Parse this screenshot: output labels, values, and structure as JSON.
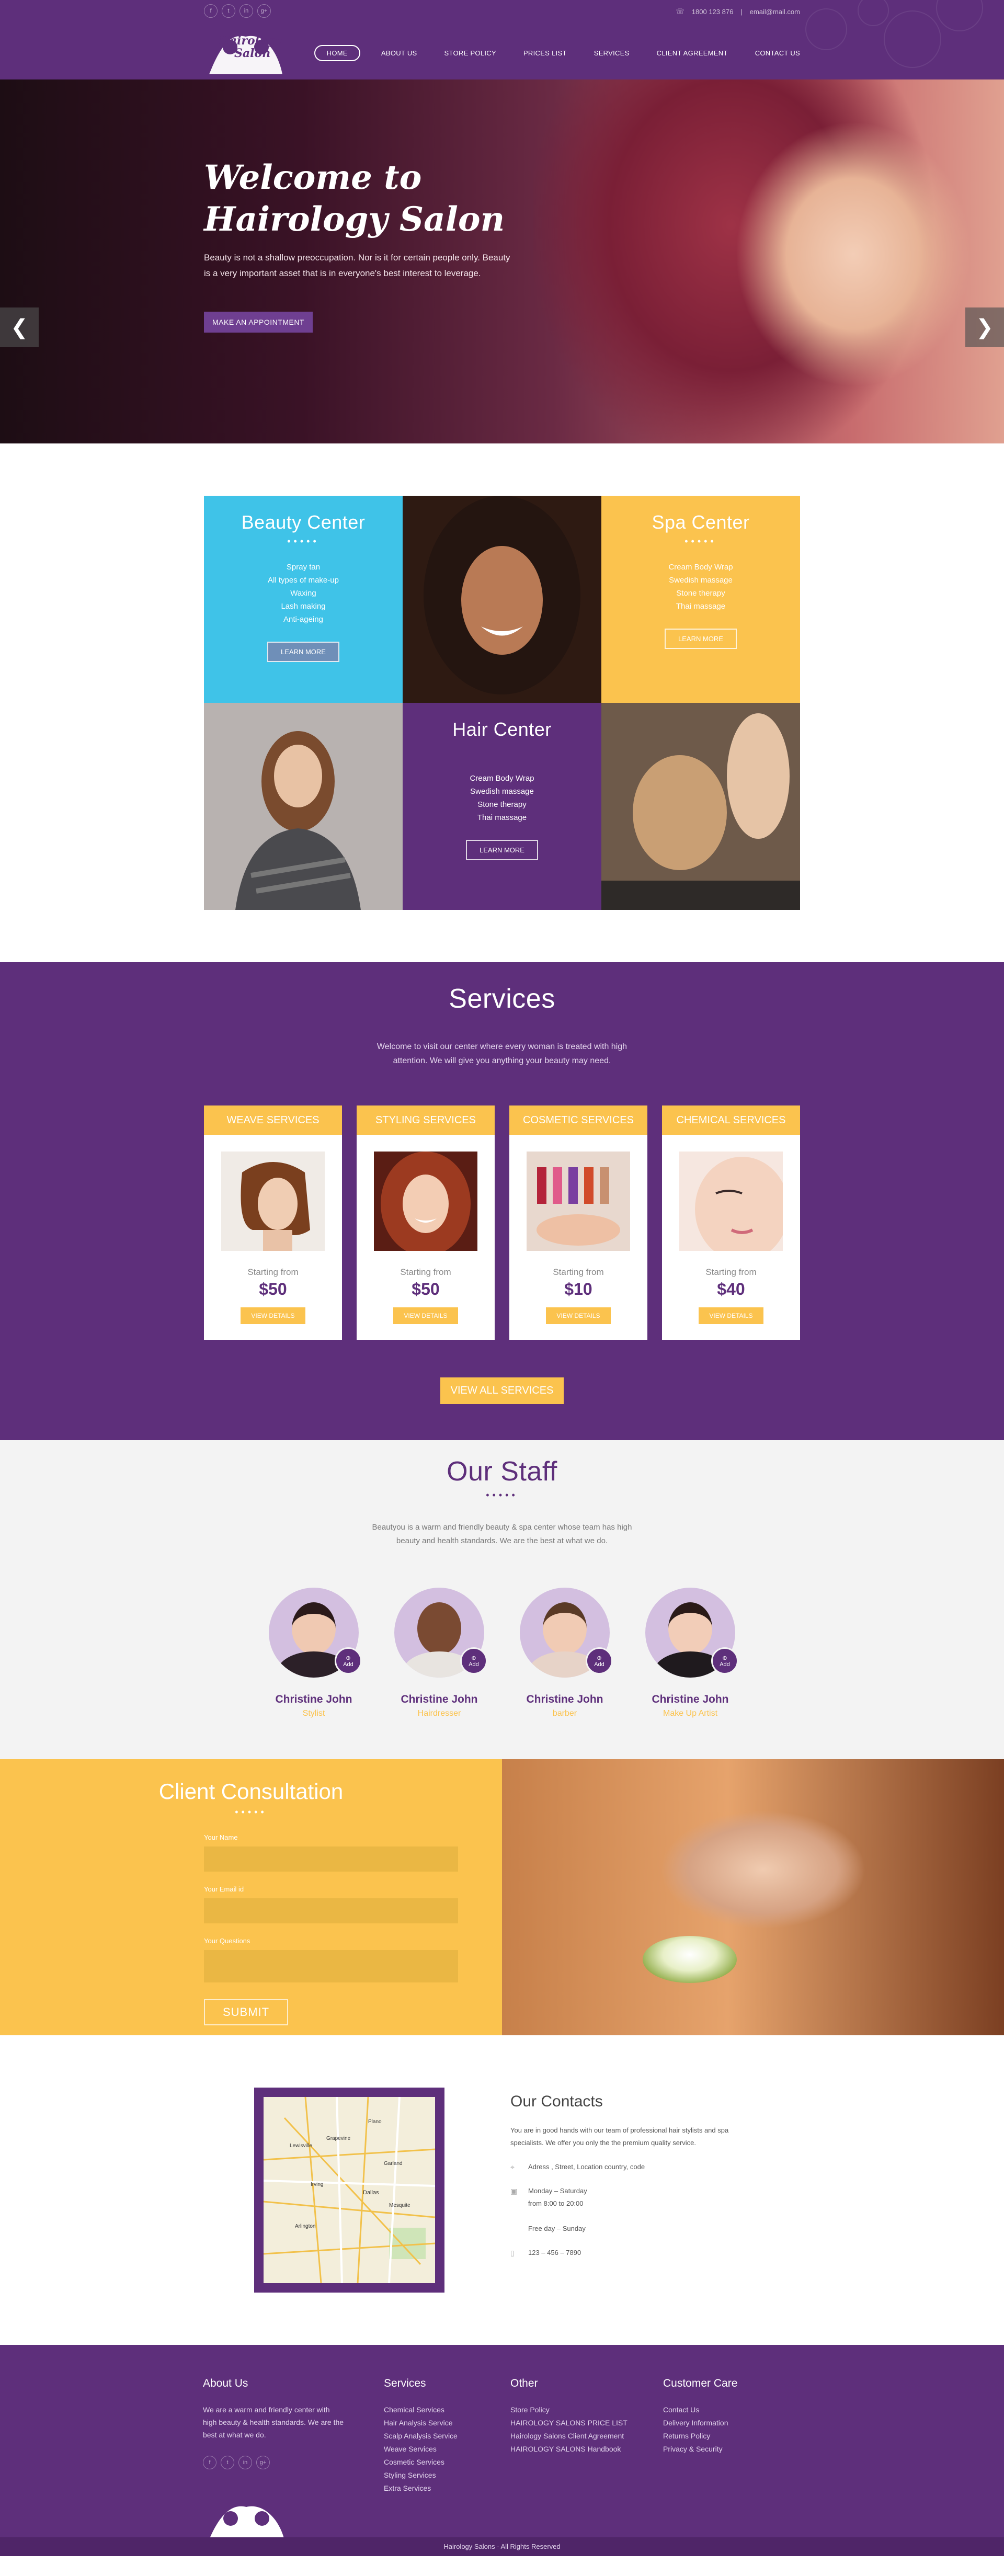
{
  "header": {
    "social": [
      "f",
      "t",
      "in",
      "g+"
    ],
    "phone": "1800 123 876",
    "email": "email@mail.com",
    "logo_text_1": "Hairology",
    "logo_text_2": "Salon",
    "nav": [
      "HOME",
      "ABOUT US",
      "STORE POLICY",
      "PRICES LIST",
      "SERVICES",
      "CLIENT AGREEMENT",
      "CONTACT US"
    ]
  },
  "hero": {
    "title_line1": "Welcome to",
    "title_line2": "Hairology Salon",
    "text": "Beauty is not a shallow preoccupation. Nor is it for certain people only. Beauty is a very important asset that is in everyone's best interest to leverage.",
    "button": "MAKE AN APPOINTMENT",
    "prev": "❮",
    "next": "❯"
  },
  "centers": {
    "beauty": {
      "title": "Beauty Center",
      "dots": "•••••",
      "items": [
        "Spray tan",
        "All types of make-up",
        "Waxing",
        "Lash making",
        "Anti-ageing"
      ],
      "button": "LEARN MORE"
    },
    "spa": {
      "title": "Spa Center",
      "dots": "•••••",
      "items": [
        "Cream Body Wrap",
        "Swedish massage",
        "Stone therapy",
        "Thai massage"
      ],
      "button": "LEARN MORE"
    },
    "hair": {
      "title": "Hair Center",
      "items": [
        "Cream Body Wrap",
        "Swedish massage",
        "Stone therapy",
        "Thai massage"
      ],
      "button": "LEARN MORE"
    }
  },
  "services": {
    "title": "Services",
    "intro": "Welcome to visit our center where every woman is treated with high attention. We will give you anything your beauty may need.",
    "cards": [
      {
        "name": "WEAVE SERVICES",
        "from": "Starting from",
        "price": "$50",
        "button": "VIEW DETAILS"
      },
      {
        "name": "STYLING SERVICES",
        "from": "Starting from",
        "price": "$50",
        "button": "VIEW DETAILS"
      },
      {
        "name": "COSMETIC SERVICES",
        "from": "Starting from",
        "price": "$10",
        "button": "VIEW DETAILS"
      },
      {
        "name": "CHEMICAL SERVICES",
        "from": "Starting from",
        "price": "$40",
        "button": "VIEW DETAILS"
      }
    ],
    "view_all": "VIEW ALL SERVICES"
  },
  "staff": {
    "title": "Our Staff",
    "dots": "•••••",
    "intro": "Beautyou is a warm and friendly beauty & spa center whose team has high beauty and health standards. We are the best at what we do.",
    "add_label": "Add",
    "members": [
      {
        "name": "Christine John",
        "role": "Stylist"
      },
      {
        "name": "Christine John",
        "role": "Hairdresser"
      },
      {
        "name": "Christine John",
        "role": "barber"
      },
      {
        "name": "Christine John",
        "role": "Make Up Artist"
      }
    ]
  },
  "consult": {
    "title": "Client Consultation",
    "dots": "•••••",
    "name_label": "Your Name",
    "email_label": "Your Email id",
    "question_label": "Your Questions",
    "submit": "SUBMIT"
  },
  "contacts": {
    "title": "Our Contacts",
    "lead": "You are in good hands with our team of professional hair stylists and spa specialists. We offer you only the the premium quality service.",
    "address": "Adress , Street, Location country, code",
    "hours_1": "Monday – Saturday",
    "hours_2": "from 8:00 to 20:00",
    "hours_3": "Free day – Sunday",
    "phone": "123 – 456 – 7890",
    "map_labels": [
      "Grapevine",
      "Irving",
      "Lewisville",
      "Dallas",
      "Arlington",
      "Mesquite",
      "Garland",
      "Plano"
    ]
  },
  "footer": {
    "about_title": "About Us",
    "about_text": "We are a warm and friendly center with high beauty & health standards. We are the best at what we do.",
    "services_title": "Services",
    "services": [
      "Chemical Services",
      "Hair Analysis Service",
      "Scalp Analysis Service",
      "Weave Services",
      "Cosmetic Services",
      "Styling Services",
      "Extra Services"
    ],
    "other_title": "Other",
    "other": [
      "Store Policy",
      "HAIROLOGY SALONS PRICE LIST",
      "Hairology Salons Client Agreement",
      "HAIROLOGY SALONS Handbook"
    ],
    "care_title": "Customer Care",
    "care": [
      "Contact Us",
      "Delivery Information",
      "Returns Policy",
      "Privacy & Security"
    ],
    "social": [
      "f",
      "t",
      "in",
      "g+"
    ],
    "copyright": "Hairology Salons - All Rights Reserved"
  },
  "colors": {
    "purple": "#5e2f7b",
    "yellow": "#fbc34e",
    "blue": "#3fc3e8"
  }
}
